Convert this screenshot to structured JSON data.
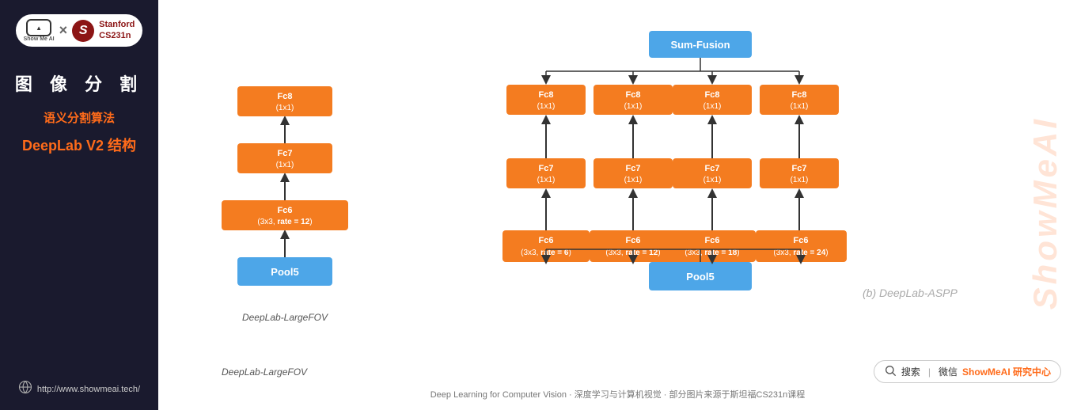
{
  "leftPanel": {
    "logoText": "Show Me AI",
    "crossSymbol": "×",
    "stanfordLine1": "Stanford",
    "stanfordLine2": "CS231n",
    "chineseTitle": "图 像 分 割",
    "subtitle": "语义分割算法",
    "deeplabTitle": "DeepLab V2 结构",
    "website": "http://www.showmeai.tech/"
  },
  "diagram": {
    "leftTitle": "DeepLab-LargeFOV",
    "rightTitle": "(b) DeepLab-ASPP",
    "sumFusion": "Sum-Fusion",
    "pool5Label": "Pool5",
    "pool5LabelRight": "Pool5",
    "leftBoxes": [
      {
        "label": "Fc8\n(1x1)",
        "type": "orange",
        "top": true
      },
      {
        "label": "Fc7\n(1x1)",
        "type": "orange"
      },
      {
        "label": "Fc6\n(3x3, rate = 12)",
        "type": "orange",
        "bold": true
      }
    ],
    "rightCols": [
      {
        "fc6": "Fc6\n(3x3, rate = 6)",
        "fc7": "Fc7\n(1x1)",
        "fc8": "Fc8\n(1x1)"
      },
      {
        "fc6": "Fc6\n(3x3, rate = 12)",
        "fc7": "Fc7\n(1x1)",
        "fc8": "Fc8\n(1x1)"
      },
      {
        "fc6": "Fc6\n(3x3, rate = 18)",
        "fc7": "Fc7\n(1x1)",
        "fc8": "Fc8\n(1x1)"
      },
      {
        "fc6": "Fc6\n(3x3, rate = 24)",
        "fc7": "Fc7\n(1x1)",
        "fc8": "Fc8\n(1x1)"
      }
    ]
  },
  "footer": {
    "searchText": "搜索",
    "divider": "|",
    "wechatText": "微信",
    "brandName": "ShowMeAI 研究中心",
    "caption": "Deep Learning for Computer Vision · 深度学习与计算机视觉 · 部分图片来源于斯坦福CS231n课程"
  },
  "watermark": "ShowMeAI"
}
